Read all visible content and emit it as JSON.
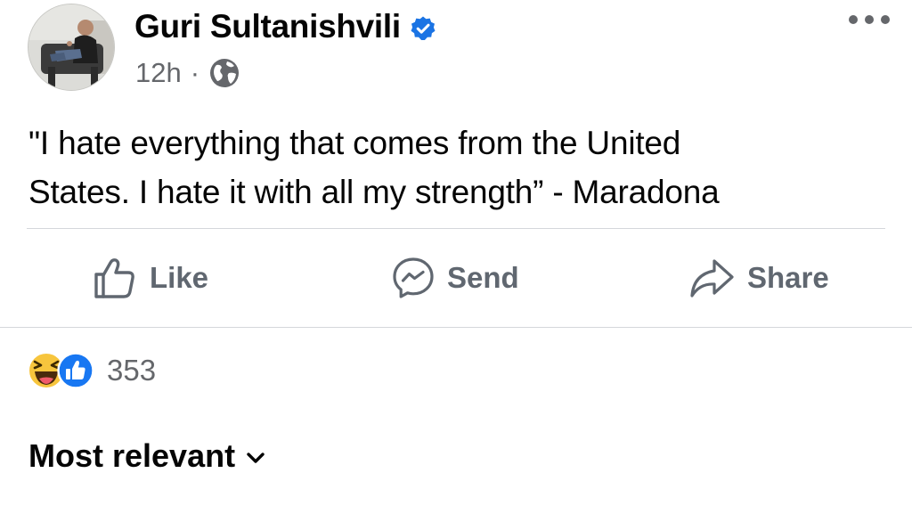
{
  "post": {
    "author": "Guri Sultanishvili",
    "verified_icon": "verified-badge-icon",
    "time": "12h",
    "separator": "·",
    "audience_icon": "globe-icon",
    "text_line1": "\"I hate everything that comes from the United",
    "text_line2": "States. I hate it with all my strength” - Maradona"
  },
  "actions": {
    "like": "Like",
    "send": "Send",
    "share": "Share"
  },
  "reactions": {
    "icons": [
      "haha-reaction-icon",
      "like-reaction-icon"
    ],
    "count": "353"
  },
  "comments": {
    "sort_label": "Most relevant"
  },
  "colors": {
    "verified_blue": "#1b74e4",
    "secondary_text": "#65676b",
    "action_text": "#606770",
    "divider": "#d5d7db"
  }
}
